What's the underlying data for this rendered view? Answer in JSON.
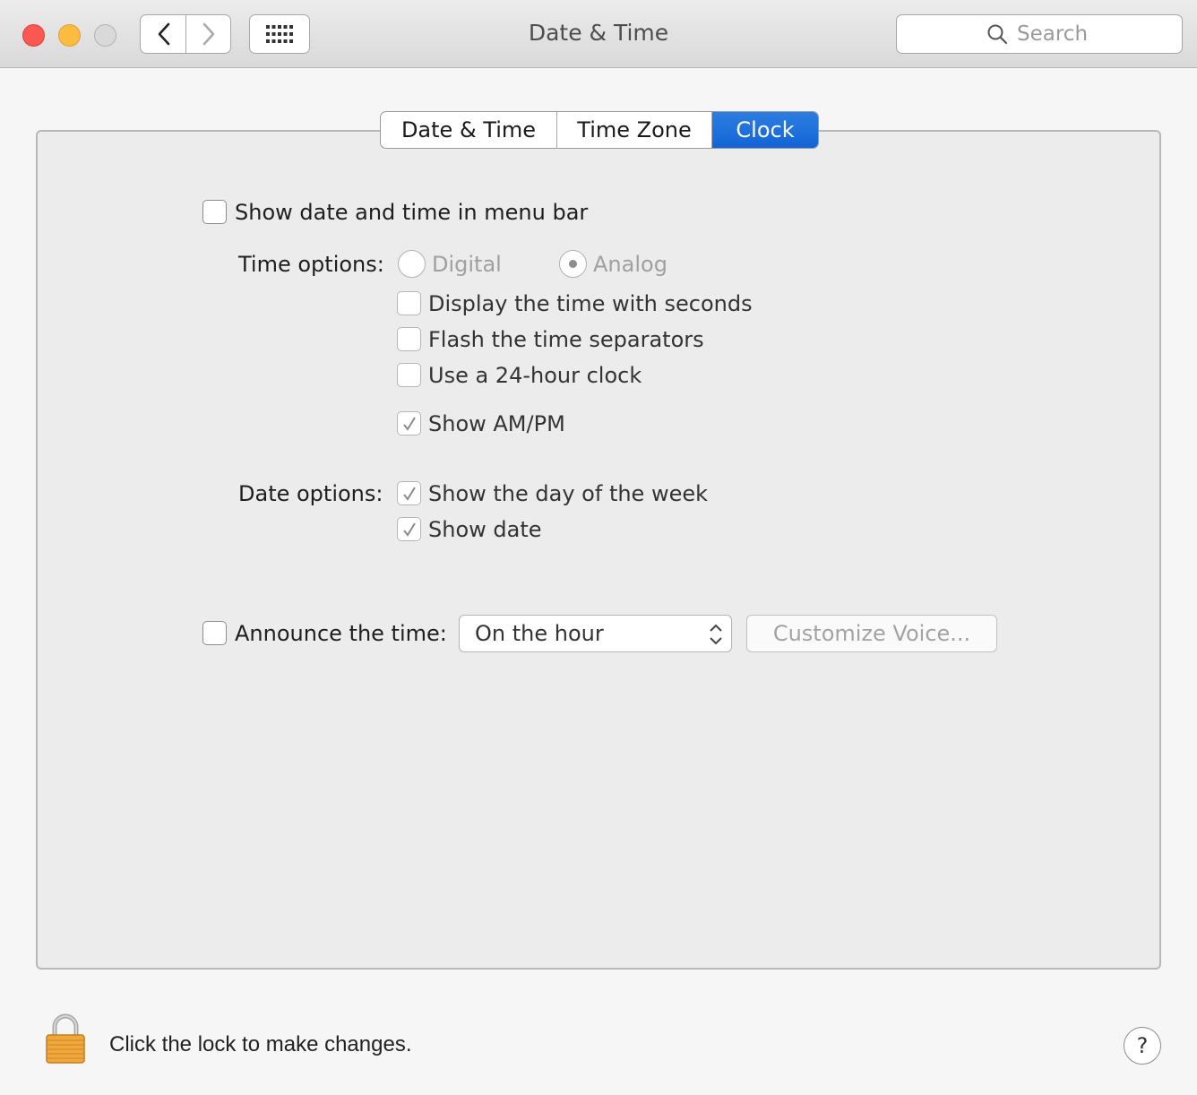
{
  "window": {
    "title": "Date & Time"
  },
  "search": {
    "placeholder": "Search"
  },
  "tabs": [
    {
      "label": "Date & Time",
      "selected": false
    },
    {
      "label": "Time Zone",
      "selected": false
    },
    {
      "label": "Clock",
      "selected": true
    }
  ],
  "clock": {
    "show_in_menu_bar": {
      "label": "Show date and time in menu bar",
      "checked": false
    },
    "time_options": {
      "label": "Time options:",
      "digital": {
        "label": "Digital",
        "selected": false
      },
      "analog": {
        "label": "Analog",
        "selected": true
      },
      "seconds": {
        "label": "Display the time with seconds",
        "checked": false
      },
      "flash_separators": {
        "label": "Flash the time separators",
        "checked": false
      },
      "clock_24h": {
        "label": "Use a 24-hour clock",
        "checked": false
      },
      "am_pm": {
        "label": "Show AM/PM",
        "checked": true
      }
    },
    "date_options": {
      "label": "Date options:",
      "day_of_week": {
        "label": "Show the day of the week",
        "checked": true
      },
      "show_date": {
        "label": "Show date",
        "checked": true
      }
    },
    "announce": {
      "label": "Announce the time:",
      "checked": false,
      "interval": "On the hour",
      "customize_label": "Customize Voice..."
    }
  },
  "footer": {
    "lock_text": "Click the lock to make changes.",
    "help_label": "?"
  }
}
